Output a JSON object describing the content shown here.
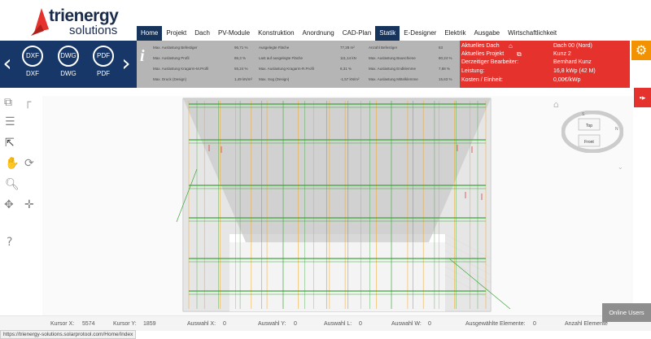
{
  "brand": {
    "name": "trienergy",
    "tagline": "solutions"
  },
  "nav": {
    "items": [
      "Home",
      "Projekt",
      "Dach",
      "PV-Module",
      "Konstruktion",
      "Anordnung",
      "CAD-Plan",
      "Statik",
      "E-Designer",
      "Elektrik",
      "Ausgabe",
      "Wirtschaftlichkeit"
    ],
    "active": [
      "Home",
      "Statik"
    ]
  },
  "export": {
    "buttons": [
      {
        "icon": "DXF",
        "label": "DXF"
      },
      {
        "icon": "DWG",
        "label": "DWG"
      },
      {
        "icon": "PDF",
        "label": "PDF"
      }
    ]
  },
  "stats": {
    "rows": [
      [
        "Max. Auslastung Befestiger",
        "96,71 %",
        "Ausgelegte Fläche",
        "77,28 m²",
        "Anzahl Befestiger",
        "63"
      ],
      [
        "Max. Auslastung Profil",
        "86,3 %",
        "Last auf ausgelegte Fläche",
        "111,14 kN",
        "Max. Auslastung Bauschiene",
        "80,24 %"
      ],
      [
        "Max. Auslastung Kragarm-M.Profil",
        "55,24 %",
        "Max. Auslastung Kragarm-R.Profil",
        "8,31 %",
        "Max. Auslastung Endklemme",
        "7,88 %"
      ],
      [
        "Max. Druck (Design)",
        "1,49 kN/m²",
        "Max. Sog (Design)",
        "-1,57 kN/m²",
        "Max. Auslastung Mittelklemme",
        "15,63 %"
      ]
    ]
  },
  "project_info": {
    "rows": [
      [
        "Aktuelles Dach",
        "Dach 00 (Nord)"
      ],
      [
        "Aktuelles Projekt",
        "Kunz 2"
      ],
      [
        "Derzeitiger Bearbeiter:",
        "Bernhard Kunz"
      ],
      [
        "Leistung:",
        "16,8 kWp (42 M)"
      ],
      [
        "Kosten / Einheit:",
        "0,00€/kWp"
      ]
    ]
  },
  "compass": {
    "top_label": "Top",
    "front_label": "Front",
    "letters": [
      "S",
      "N"
    ]
  },
  "statusbar": {
    "items": [
      "Kursor X:",
      "5574",
      "Kursor Y:",
      "1859",
      "Auswahl X:",
      "0",
      "Auswahl Y:",
      "0",
      "Auswahl L:",
      "0",
      "Auswahl W:",
      "0",
      "Ausgewählte Elemente:",
      "0",
      "Anzahl Elemente"
    ],
    "online_users": "Online Users",
    "url": "https://trienergy-solutions.solarprotool.com/Home/Index"
  },
  "colors": {
    "navy": "#173768",
    "red": "#e5322d",
    "orange": "#f39200",
    "grey": "#b5b5b5",
    "module_green": "#3aa63a",
    "rail_orange": "#f5a623"
  }
}
